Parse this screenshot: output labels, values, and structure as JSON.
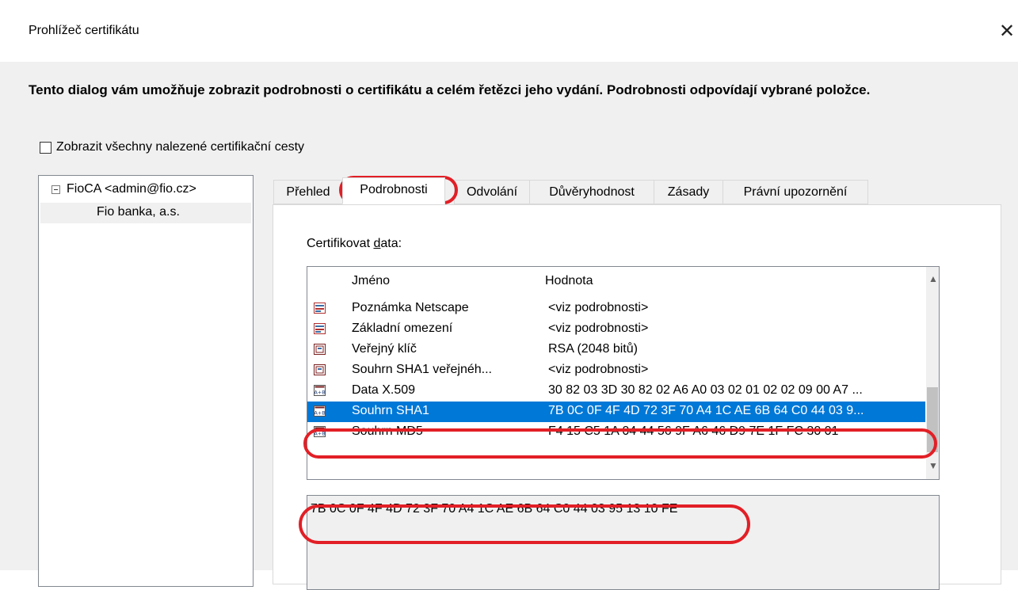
{
  "window": {
    "title": "Prohlížeč certifikátu",
    "close_glyph": "✕"
  },
  "intro": {
    "text": "Tento dialog vám umožňuje zobrazit podrobnosti o certifikátu a celém řetězci jeho vydání. Podrobnosti odpovídají vybrané položce."
  },
  "show_all_paths": {
    "label": "Zobrazit všechny nalezené certifikační cesty",
    "checked": false
  },
  "tree": {
    "root": "FioCA <admin@fio.cz>",
    "child": "Fio banka, a.s."
  },
  "tabs": [
    {
      "label": "Přehled"
    },
    {
      "label": "Podrobnosti"
    },
    {
      "label": "Odvolání"
    },
    {
      "label": "Důvěryhodnost"
    },
    {
      "label": "Zásady"
    },
    {
      "label": "Právní upozornění"
    }
  ],
  "active_tab": "Podrobnosti",
  "details": {
    "label_prefix": "Certifikovat ",
    "label_accel": "d",
    "label_suffix": "ata:",
    "columns": {
      "name": "Jméno",
      "value": "Hodnota"
    },
    "rows": [
      {
        "name": "Poznámka Netscape",
        "value": "<viz podrobnosti>",
        "icon": "extension-icon"
      },
      {
        "name": "Základní omezení",
        "value": "<viz podrobnosti>",
        "icon": "extension-icon"
      },
      {
        "name": "Veřejný klíč",
        "value": "RSA (2048 bitů)",
        "icon": "key-icon"
      },
      {
        "name": "Souhrn SHA1 veřejnéh...",
        "value": "<viz podrobnosti>",
        "icon": "key-icon"
      },
      {
        "name": "Data X.509",
        "value": "30 82 03 3D 30 82 02 A6 A0 03 02 01 02 02 09 00 A7 ...",
        "icon": "binary-icon"
      },
      {
        "name": "Souhrn SHA1",
        "value": "7B 0C 0F 4F 4D 72 3F 70 A4 1C AE 6B 64 C0 44 03 9...",
        "icon": "binary-icon",
        "selected": true
      },
      {
        "name": "Souhrn MD5",
        "value": "F4 15 C5 1A 04 44 56 9F A6 46 D9 7E 1F FC 30 01",
        "icon": "binary-icon"
      }
    ],
    "detail_value": "7B 0C 0F 4F 4D 72 3F 70 A4 1C AE 6B 64 C0 44 03 95 13 10 FE"
  },
  "colors": {
    "selection": "#0078d7",
    "annotation": "#e21f26",
    "dialog_bg": "#f0f0f0"
  }
}
